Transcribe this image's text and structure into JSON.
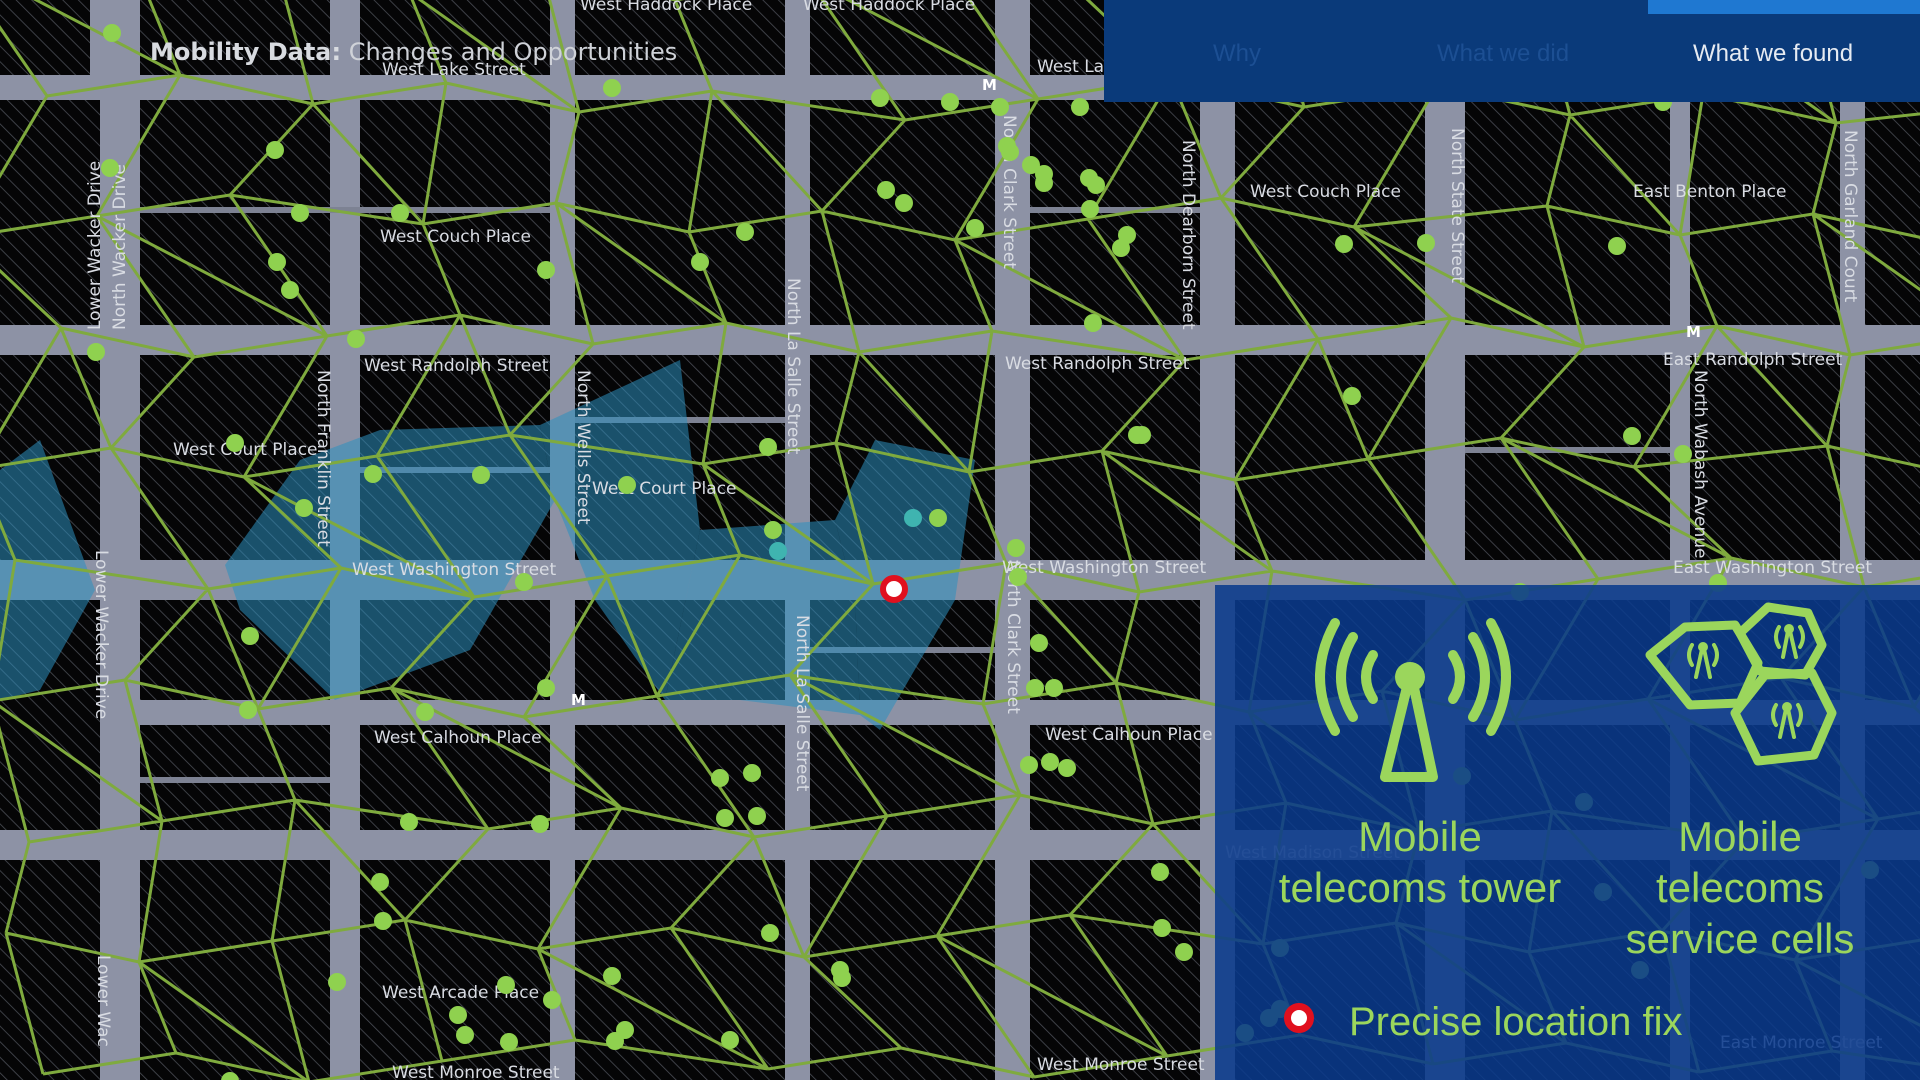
{
  "header": {
    "title_bold": "Mobility Data:",
    "title_rest": " Changes and Opportunities"
  },
  "nav": {
    "tabs": [
      {
        "label": "Why",
        "active": false
      },
      {
        "label": "What we did",
        "active": false
      },
      {
        "label": "What we found",
        "active": true
      }
    ]
  },
  "legend": {
    "tower_label": "Mobile telecoms tower",
    "cells_label": "Mobile telecoms service cells",
    "fix_label": "Precise location fix",
    "tower_icon": "radio-tower-icon",
    "cells_icon": "service-cells-icon"
  },
  "map": {
    "street_labels": [
      "West Haddock Place",
      "West Haddock Place",
      "West Lake Street",
      "West Lake",
      "Lower Wacker Drive",
      "North Wacker Drive",
      "West Couch Place",
      "West Couch Place",
      "East Benton Place",
      "North Clark Street",
      "North Dearborn Street",
      "North State Street",
      "North Garland Court",
      "West Randolph Street",
      "West Randolph Street",
      "East Randolph Street",
      "North Franklin Street",
      "North Wells Street",
      "North La Salle Street",
      "West Court Place",
      "West Court Place",
      "North Wabash Avenue",
      "West Washington Street",
      "West Washington Street",
      "East Washington Street",
      "Lower Wacker Drive",
      "North La Salle Street",
      "North Clark Street",
      "West Calhoun Place",
      "West Calhoun Place",
      "West Arcade Place",
      "West Monroe Street",
      "West Monroe Street",
      "Lower Wac",
      "West Madison Street",
      "East Monroe Street"
    ],
    "station_marker": "M",
    "colors": {
      "background": "#0b0c10",
      "streets": "#8d92a5",
      "cell_edges": "#7faa3e",
      "towers": "#8fd14f",
      "highlight_cells": "#2b8fc0",
      "location_fix": "#e0101e"
    }
  }
}
